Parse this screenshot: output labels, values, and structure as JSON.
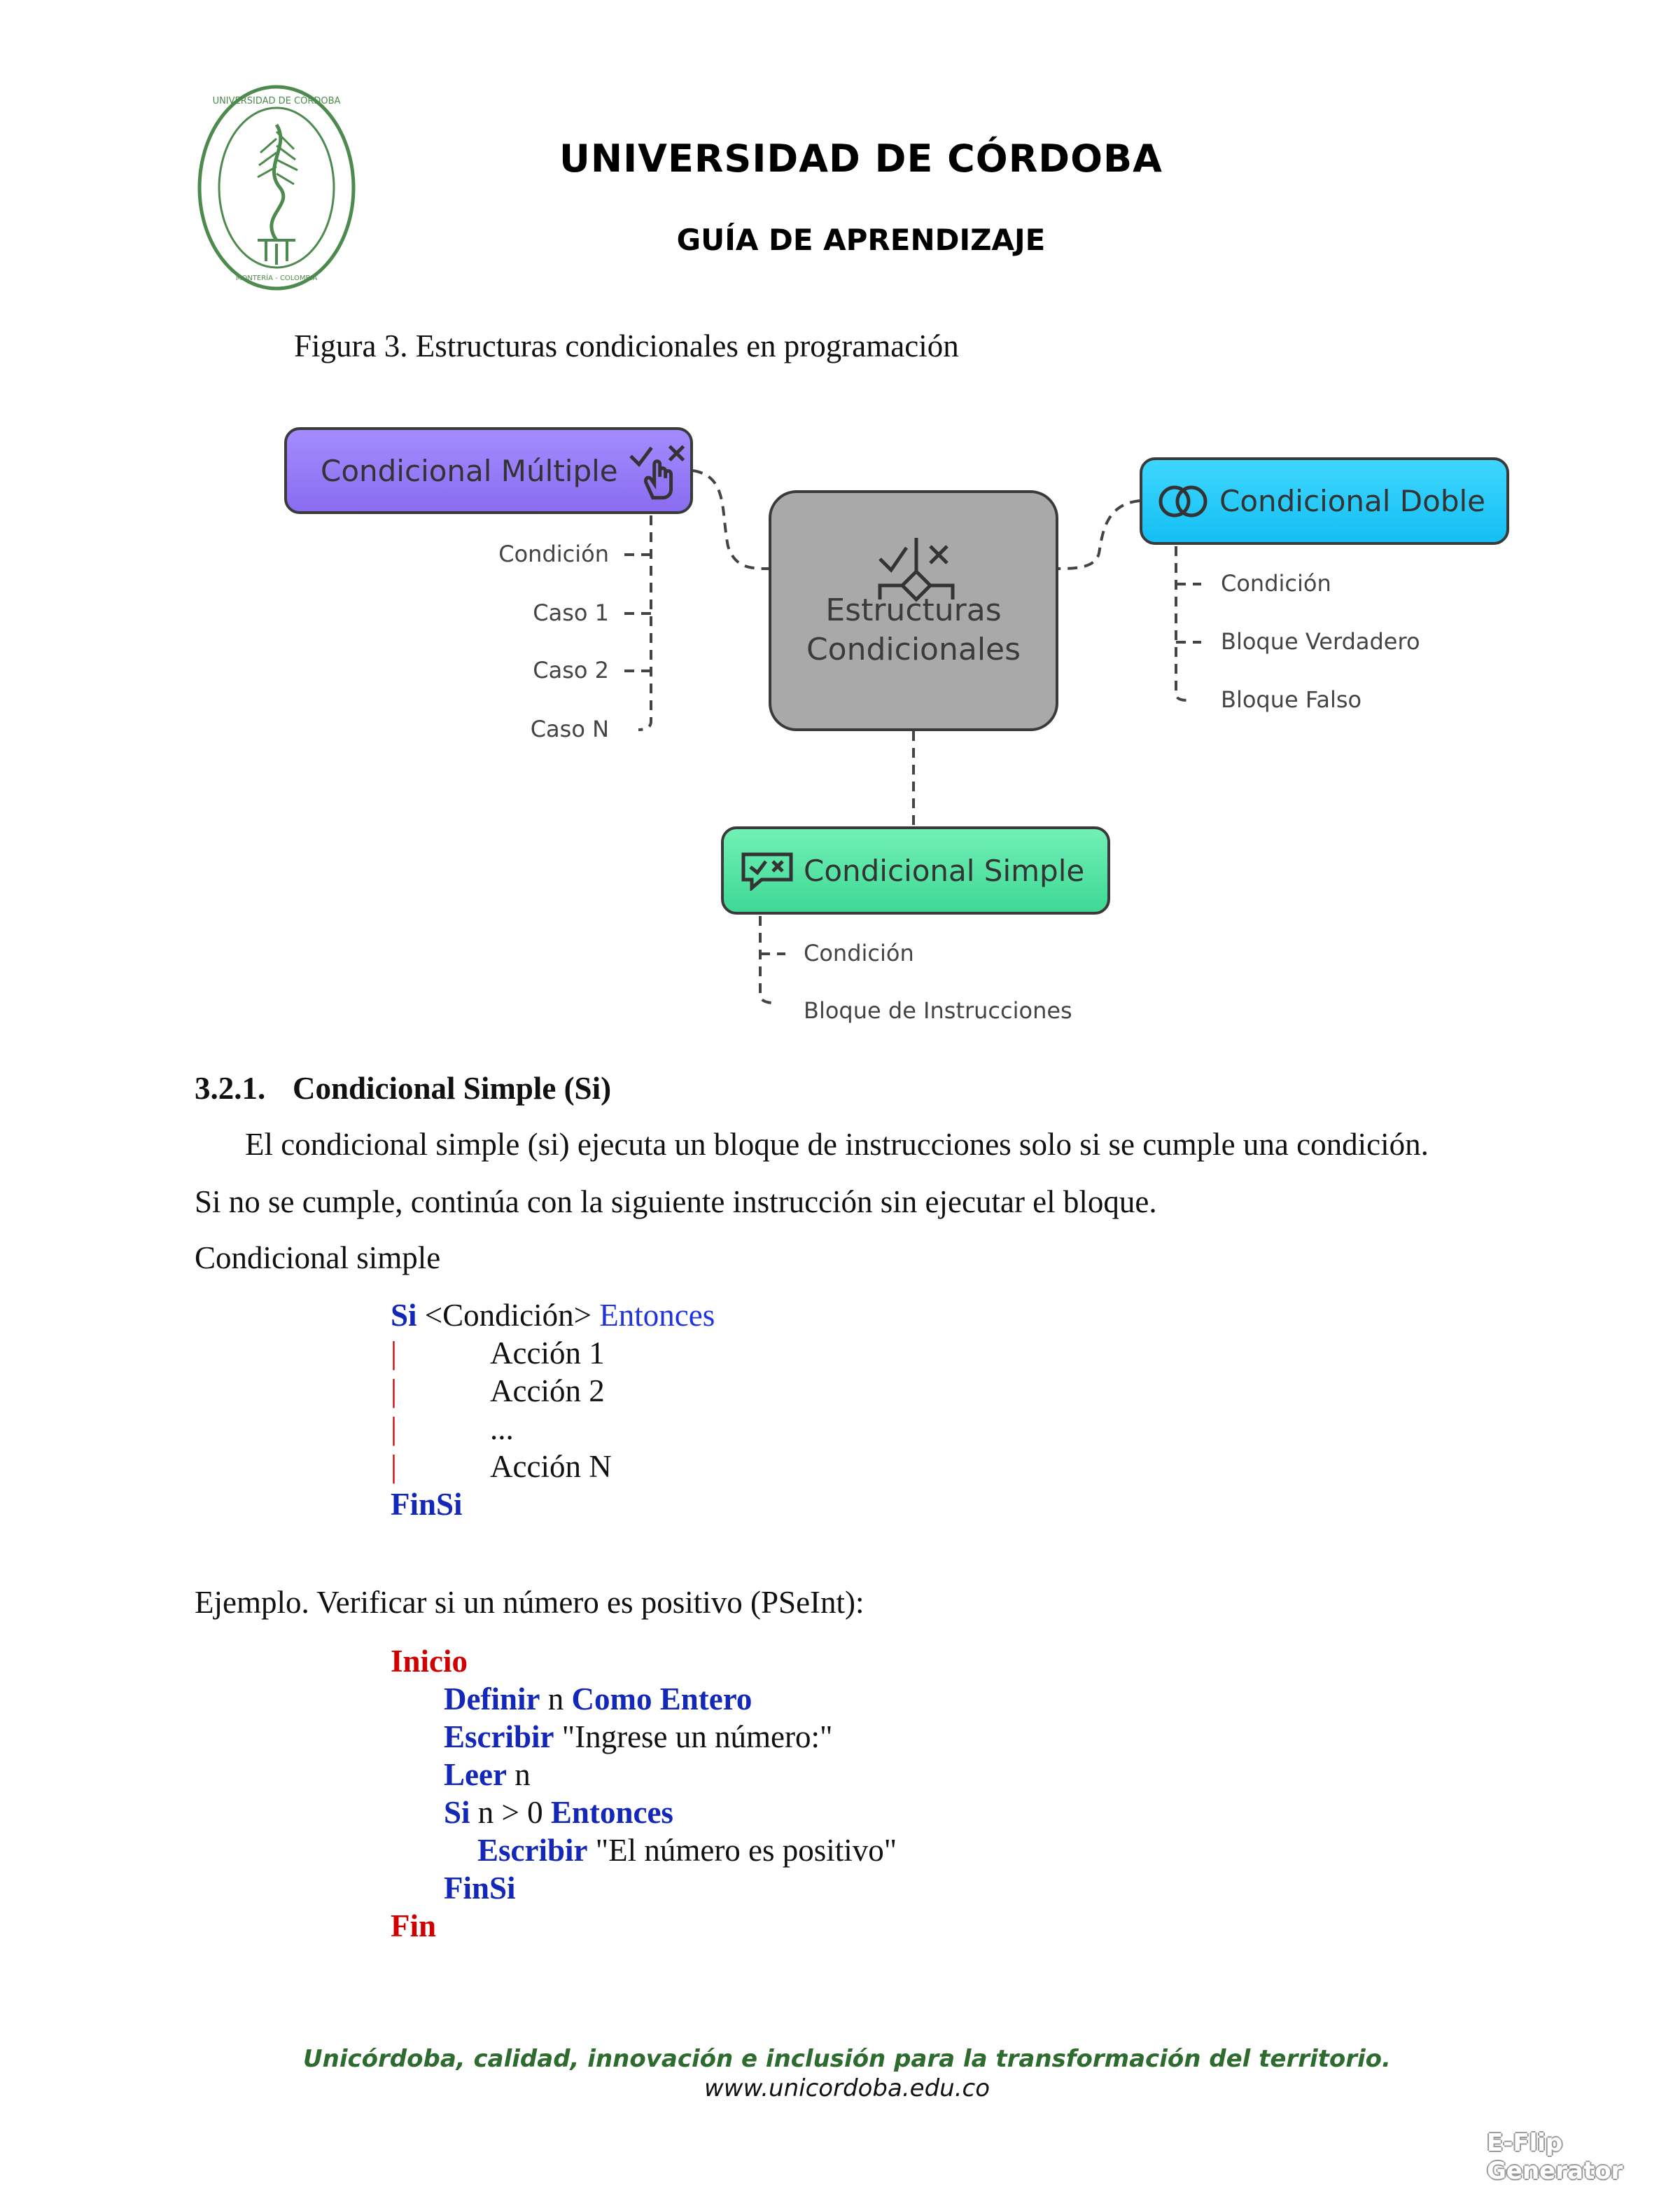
{
  "header": {
    "seal_text_top": "UNIVERSIDAD DE CÓRDOBA",
    "seal_text_bottom": "MONTERÍA - COLOMBIA",
    "university": "UNIVERSIDAD DE CÓRDOBA",
    "guide": "GUÍA DE APRENDIZAJE"
  },
  "figure": {
    "caption": "Figura 3. Estructuras condicionales en programación",
    "center": "Estructuras\nCondicionales",
    "multiple": {
      "label": "Condicional Múltiple",
      "leaves": [
        "Condición",
        "Caso 1",
        "Caso 2",
        "Caso N"
      ]
    },
    "double": {
      "label": "Condicional Doble",
      "leaves": [
        "Condición",
        "Bloque Verdadero",
        "Bloque Falso"
      ]
    },
    "simple": {
      "label": "Condicional Simple",
      "leaves": [
        "Condición",
        "Bloque de Instrucciones"
      ]
    }
  },
  "section": {
    "number": "3.2.1.",
    "title": "Condicional Simple (Si)",
    "para_line1": "El condicional simple (si) ejecuta un bloque de instrucciones solo si se cumple una condición.",
    "para_line2": "Si no se cumple, continúa con la siguiente instrucción sin ejecutar el bloque.",
    "syntax_label": "Condicional simple",
    "syntax": {
      "si": "Si",
      "cond": "<Condición>",
      "entonces": "Entonces",
      "bar": "|",
      "actions": [
        "Acción 1",
        "Acción 2",
        "...",
        "Acción N"
      ],
      "finsi": "FinSi"
    },
    "example_label": "Ejemplo. Verificar si un número es positivo (PSeInt):",
    "example": {
      "inicio": "Inicio",
      "definir": "Definir",
      "var_n": "n",
      "como_entero": "Como Entero",
      "escribir": "Escribir",
      "prompt_str": "\"Ingrese un número:\"",
      "leer": "Leer",
      "si": "Si",
      "condition": "n > 0",
      "entonces": "Entonces",
      "positive_str": "\"El número es positivo\"",
      "finsi": "FinSi",
      "fin": "Fin"
    }
  },
  "footer": {
    "slogan": "Unicórdoba, calidad, innovación e inclusión para la transformación del territorio.",
    "url": "www.unicordoba.edu.co",
    "watermark": "E-Flip Generator"
  }
}
